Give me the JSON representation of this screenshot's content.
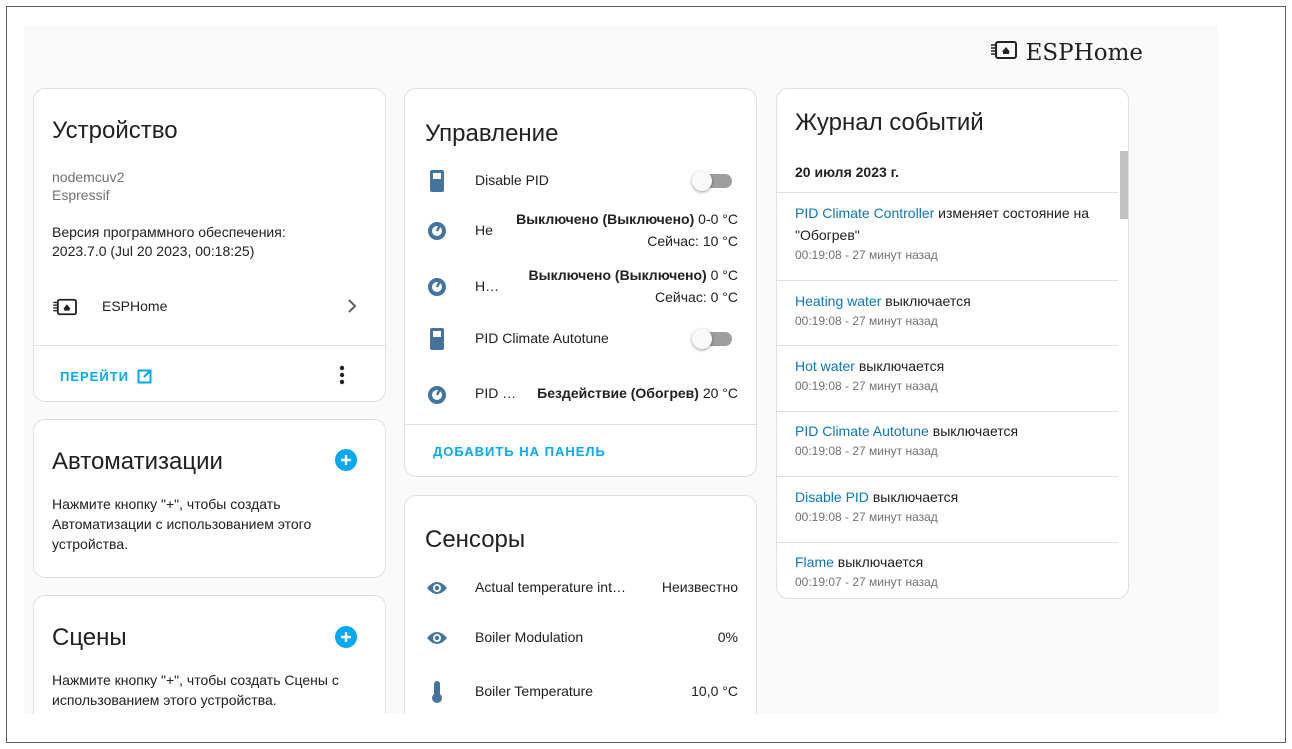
{
  "brand": {
    "name": "ESPHome",
    "icon": "esphome-chip-icon"
  },
  "device_card": {
    "title": "Устройство",
    "model": "nodemcuv2",
    "manufacturer": "Espressif",
    "firmware_line1": "Версия программного обеспечения:",
    "firmware_line2": "2023.7.0 (Jul 20 2023, 00:18:25)",
    "integration_label": "ESPHome",
    "visit_label": "ПЕРЕЙТИ"
  },
  "automations_card": {
    "title": "Автоматизации",
    "description": "Нажмите кнопку \"+\", чтобы создать Автоматизации с использованием этого устройства."
  },
  "scenes_card": {
    "title": "Сцены",
    "description": "Нажмите кнопку \"+\", чтобы создать Сцены с использованием этого устройства."
  },
  "controls_card": {
    "title": "Управление",
    "entities": [
      {
        "name": "Disable PID",
        "icon": "switch-icon",
        "type": "toggle",
        "on": false
      },
      {
        "name": "Не",
        "icon": "thermostat-icon",
        "state": "Выключено (Выключено)",
        "state_extra": "0-0 °C",
        "current": "Сейчас: 10 °C"
      },
      {
        "name": "Н…",
        "icon": "thermostat-icon",
        "state": "Выключено (Выключено)",
        "state_extra": "0 °C",
        "current": "Сейчас: 0 °C"
      },
      {
        "name": "PID Climate Autotune",
        "icon": "switch-icon",
        "type": "toggle",
        "on": false
      },
      {
        "name": "PID …",
        "icon": "thermostat-icon",
        "state": "Бездействие (Обогрев)",
        "state_extra": "20 °C"
      }
    ],
    "add_label": "ДОБАВИТЬ НА ПАНЕЛЬ"
  },
  "sensors_card": {
    "title": "Сенсоры",
    "entities": [
      {
        "name": "Actual temperature int…",
        "icon": "eye-icon",
        "value": "Неизвестно"
      },
      {
        "name": "Boiler Modulation",
        "icon": "eye-icon",
        "value": "0%"
      },
      {
        "name": "Boiler Temperature",
        "icon": "thermometer-icon",
        "value": "10,0 °C"
      }
    ]
  },
  "logbook_card": {
    "title": "Журнал событий",
    "date": "20 июля 2023 г.",
    "entries": [
      {
        "entity": "PID Climate Controller",
        "action": "изменяет состояние на \"Обогрев\"",
        "time": "00:19:08 - 27 минут назад"
      },
      {
        "entity": "Heating water",
        "action": "выключается",
        "time": "00:19:08 - 27 минут назад"
      },
      {
        "entity": "Hot water",
        "action": "выключается",
        "time": "00:19:08 - 27 минут назад"
      },
      {
        "entity": "PID Climate Autotune",
        "action": "выключается",
        "time": "00:19:08 - 27 минут назад"
      },
      {
        "entity": "Disable PID",
        "action": "выключается",
        "time": "00:19:08 - 27 минут назад"
      },
      {
        "entity": "Flame",
        "action": "выключается",
        "time": "00:19:07 - 27 минут назад"
      }
    ]
  },
  "colors": {
    "accent": "#03a9f4",
    "entity_icon": "#44739e",
    "link": "#0b76bd"
  }
}
